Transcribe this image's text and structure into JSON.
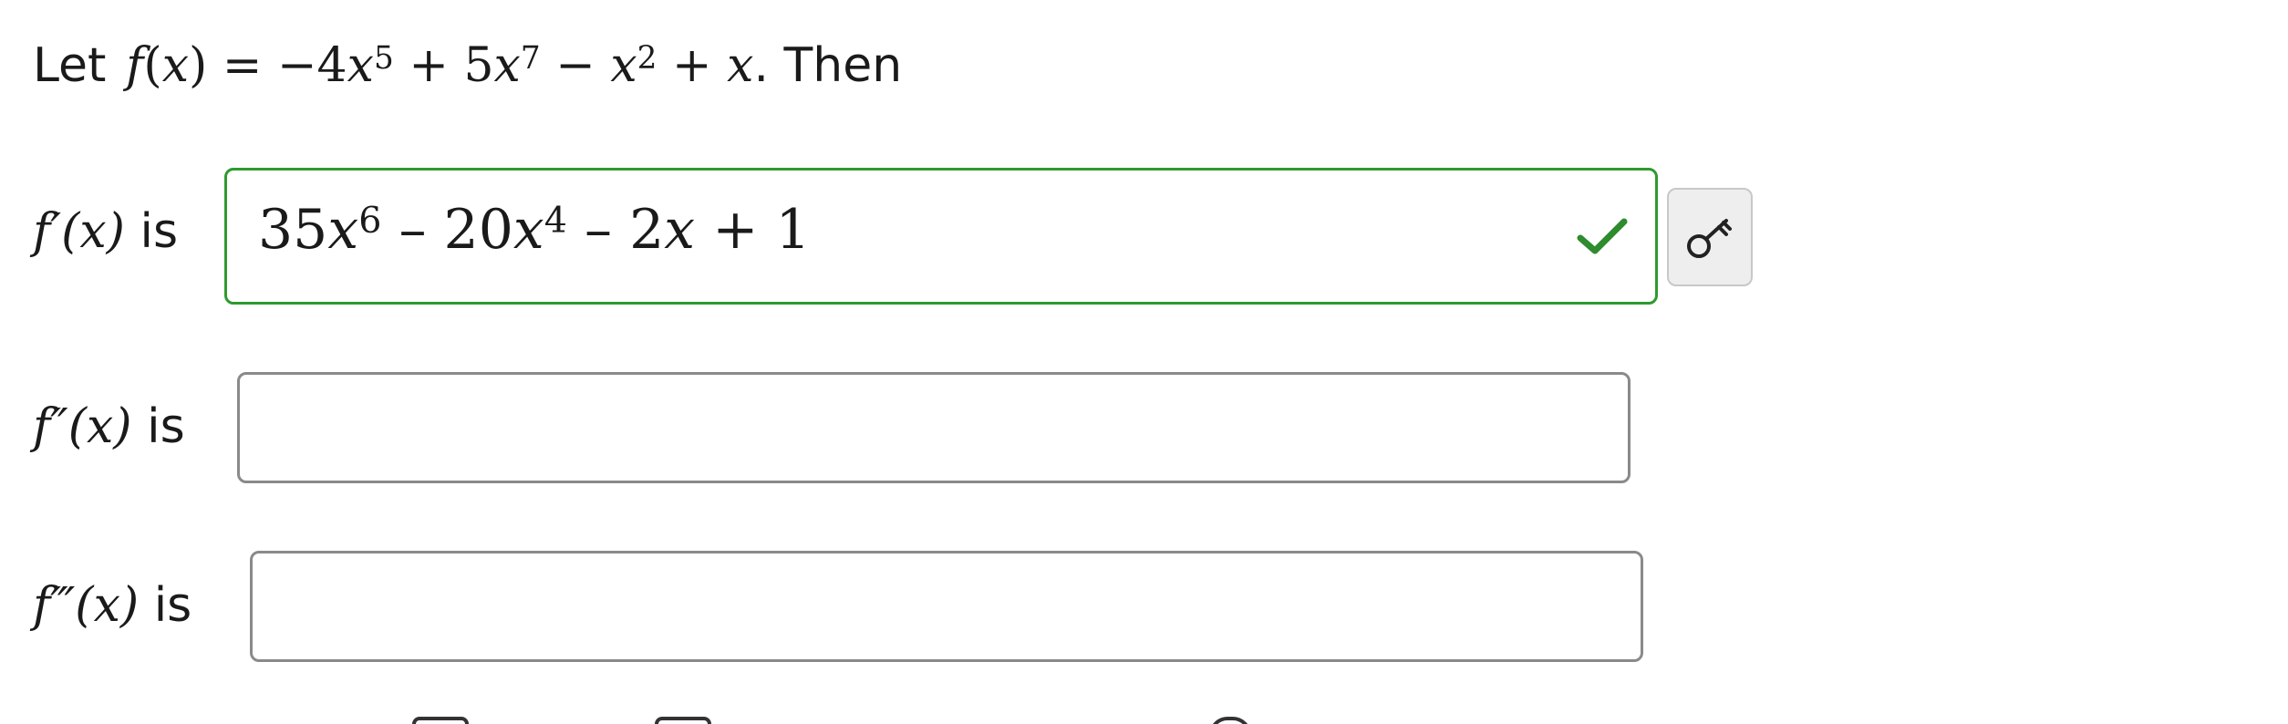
{
  "problem": {
    "prefix": "Let",
    "function_name": "f",
    "argument": "x",
    "coef_a": "−4",
    "exp_a": "5",
    "coef_b": "5",
    "exp_b": "7",
    "exp_c": "2",
    "suffix": ". Then"
  },
  "questions": [
    {
      "label_fn": "f",
      "label_prime": "′",
      "label_arg": "(x)",
      "label_is": "is",
      "status": "correct",
      "answer": {
        "coef1": "35",
        "var1": "x",
        "exp1": "6",
        "op1": " – ",
        "coef2": "20",
        "var2": "x",
        "exp2": "4",
        "op2": " – ",
        "coef3": "2",
        "var3": "x",
        "op3": " + ",
        "const": "1"
      }
    },
    {
      "label_fn": "f",
      "label_prime": "″",
      "label_arg": "(x)",
      "label_is": "is",
      "status": "empty",
      "answer": ""
    },
    {
      "label_fn": "f",
      "label_prime": "‴",
      "label_arg": "(x)",
      "label_is": "is",
      "status": "empty",
      "answer": ""
    }
  ],
  "icons": {
    "check": "check-icon",
    "key": "key-icon"
  },
  "colors": {
    "correct_border": "#2e9a2e",
    "check": "#2e8b2e",
    "empty_border": "#8a8a8a",
    "key_button_bg": "#eeeeee"
  }
}
